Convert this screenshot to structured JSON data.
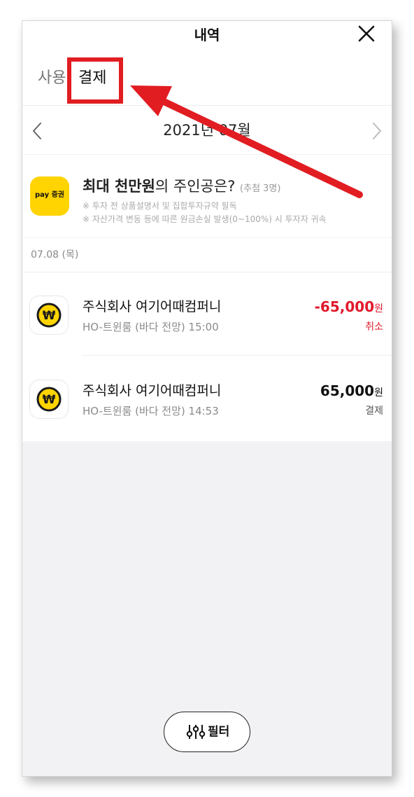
{
  "header": {
    "title": "내역",
    "close_icon": "close-icon"
  },
  "tabs": [
    {
      "label": "사용",
      "selected": false
    },
    {
      "label": "결제",
      "selected": true
    }
  ],
  "month_nav": {
    "label": "2021년 07월",
    "prev_icon": "chevron-left-icon",
    "next_icon": "chevron-right-icon"
  },
  "ad": {
    "logo_text": "pay 증권",
    "title_bold": "최대 천만원",
    "title_rest": "의 주인공은?",
    "title_sub": "(추첨 3명)",
    "notes": [
      "※ 투자 전 상품설명서 및 집합투자규약 필독",
      "※ 자산가격 변동 등에 따른 원금손실 발생(0~100%) 시 투자자 귀속"
    ]
  },
  "date_group": "07.08 (목)",
  "transactions": [
    {
      "merchant": "주식회사 여기어때컴퍼니",
      "detail": "HO-트윈룸 (바다 전망) 15:00",
      "amount": "-65,000",
      "currency": "원",
      "status": "취소",
      "status_color": "#e0192b"
    },
    {
      "merchant": "주식회사 여기어때컴퍼니",
      "detail": "HO-트윈룸 (바다 전망) 14:53",
      "amount": "65,000",
      "currency": "원",
      "status": "결제",
      "status_color": "#555555"
    }
  ],
  "filter": {
    "label": "필터",
    "icon": "sliders-icon"
  },
  "colors": {
    "accent_red": "#e11d22",
    "logo_yellow": "#ffd400",
    "background": "#f2f2f4"
  }
}
